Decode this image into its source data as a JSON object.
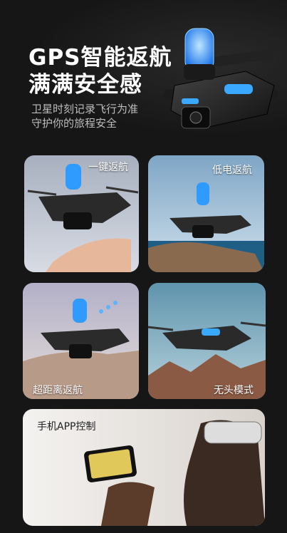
{
  "hero": {
    "title_line1": "GPS智能返航",
    "title_line2": "满满安全感",
    "subtitle_line1": "卫星时刻记录飞行为准",
    "subtitle_line2": "守护你的旅程安全"
  },
  "features": [
    {
      "label": "一键返航"
    },
    {
      "label": "低电返航"
    },
    {
      "label": "超距离返航"
    },
    {
      "label": "无头模式"
    },
    {
      "label": "手机APP控制"
    }
  ],
  "colors": {
    "background": "#161616",
    "accent_blue": "#3aa8ff",
    "text_white": "#ffffff",
    "text_gray": "#bdbdbd"
  }
}
